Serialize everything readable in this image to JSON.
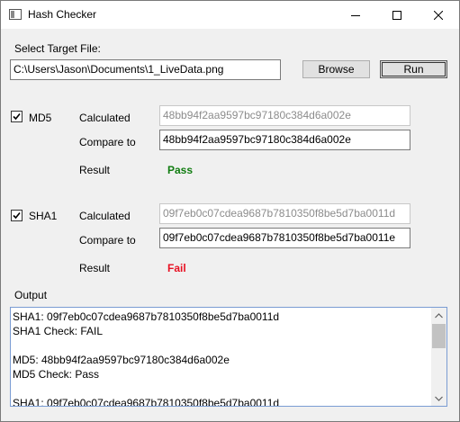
{
  "window": {
    "title": "Hash Checker",
    "minimize_icon": "minimize-icon",
    "maximize_icon": "maximize-icon",
    "close_icon": "close-icon"
  },
  "file": {
    "label": "Select Target File:",
    "path": "C:\\Users\\Jason\\Documents\\1_LiveData.png",
    "browse_label": "Browse",
    "run_label": "Run"
  },
  "md5": {
    "checked": true,
    "label": "MD5",
    "calculated_label": "Calculated",
    "calculated_value": "48bb94f2aa9597bc97180c384d6a002e",
    "compare_label": "Compare to",
    "compare_value": "48bb94f2aa9597bc97180c384d6a002e",
    "result_label": "Result",
    "result_value": "Pass",
    "result_color": "#107c10"
  },
  "sha1": {
    "checked": true,
    "label": "SHA1",
    "calculated_label": "Calculated",
    "calculated_value": "09f7eb0c07cdea9687b7810350f8be5d7ba0011d",
    "compare_label": "Compare to",
    "compare_value": "09f7eb0c07cdea9687b7810350f8be5d7ba0011e",
    "result_label": "Result",
    "result_value": "Fail",
    "result_color": "#e81123"
  },
  "output": {
    "label": "Output",
    "lines": [
      "SHA1: 09f7eb0c07cdea9687b7810350f8be5d7ba0011d",
      "SHA1 Check: FAIL",
      "",
      "MD5: 48bb94f2aa9597bc97180c384d6a002e",
      "MD5 Check: Pass",
      "",
      "SHA1: 09f7eb0c07cdea9687b7810350f8be5d7ba0011d"
    ]
  }
}
